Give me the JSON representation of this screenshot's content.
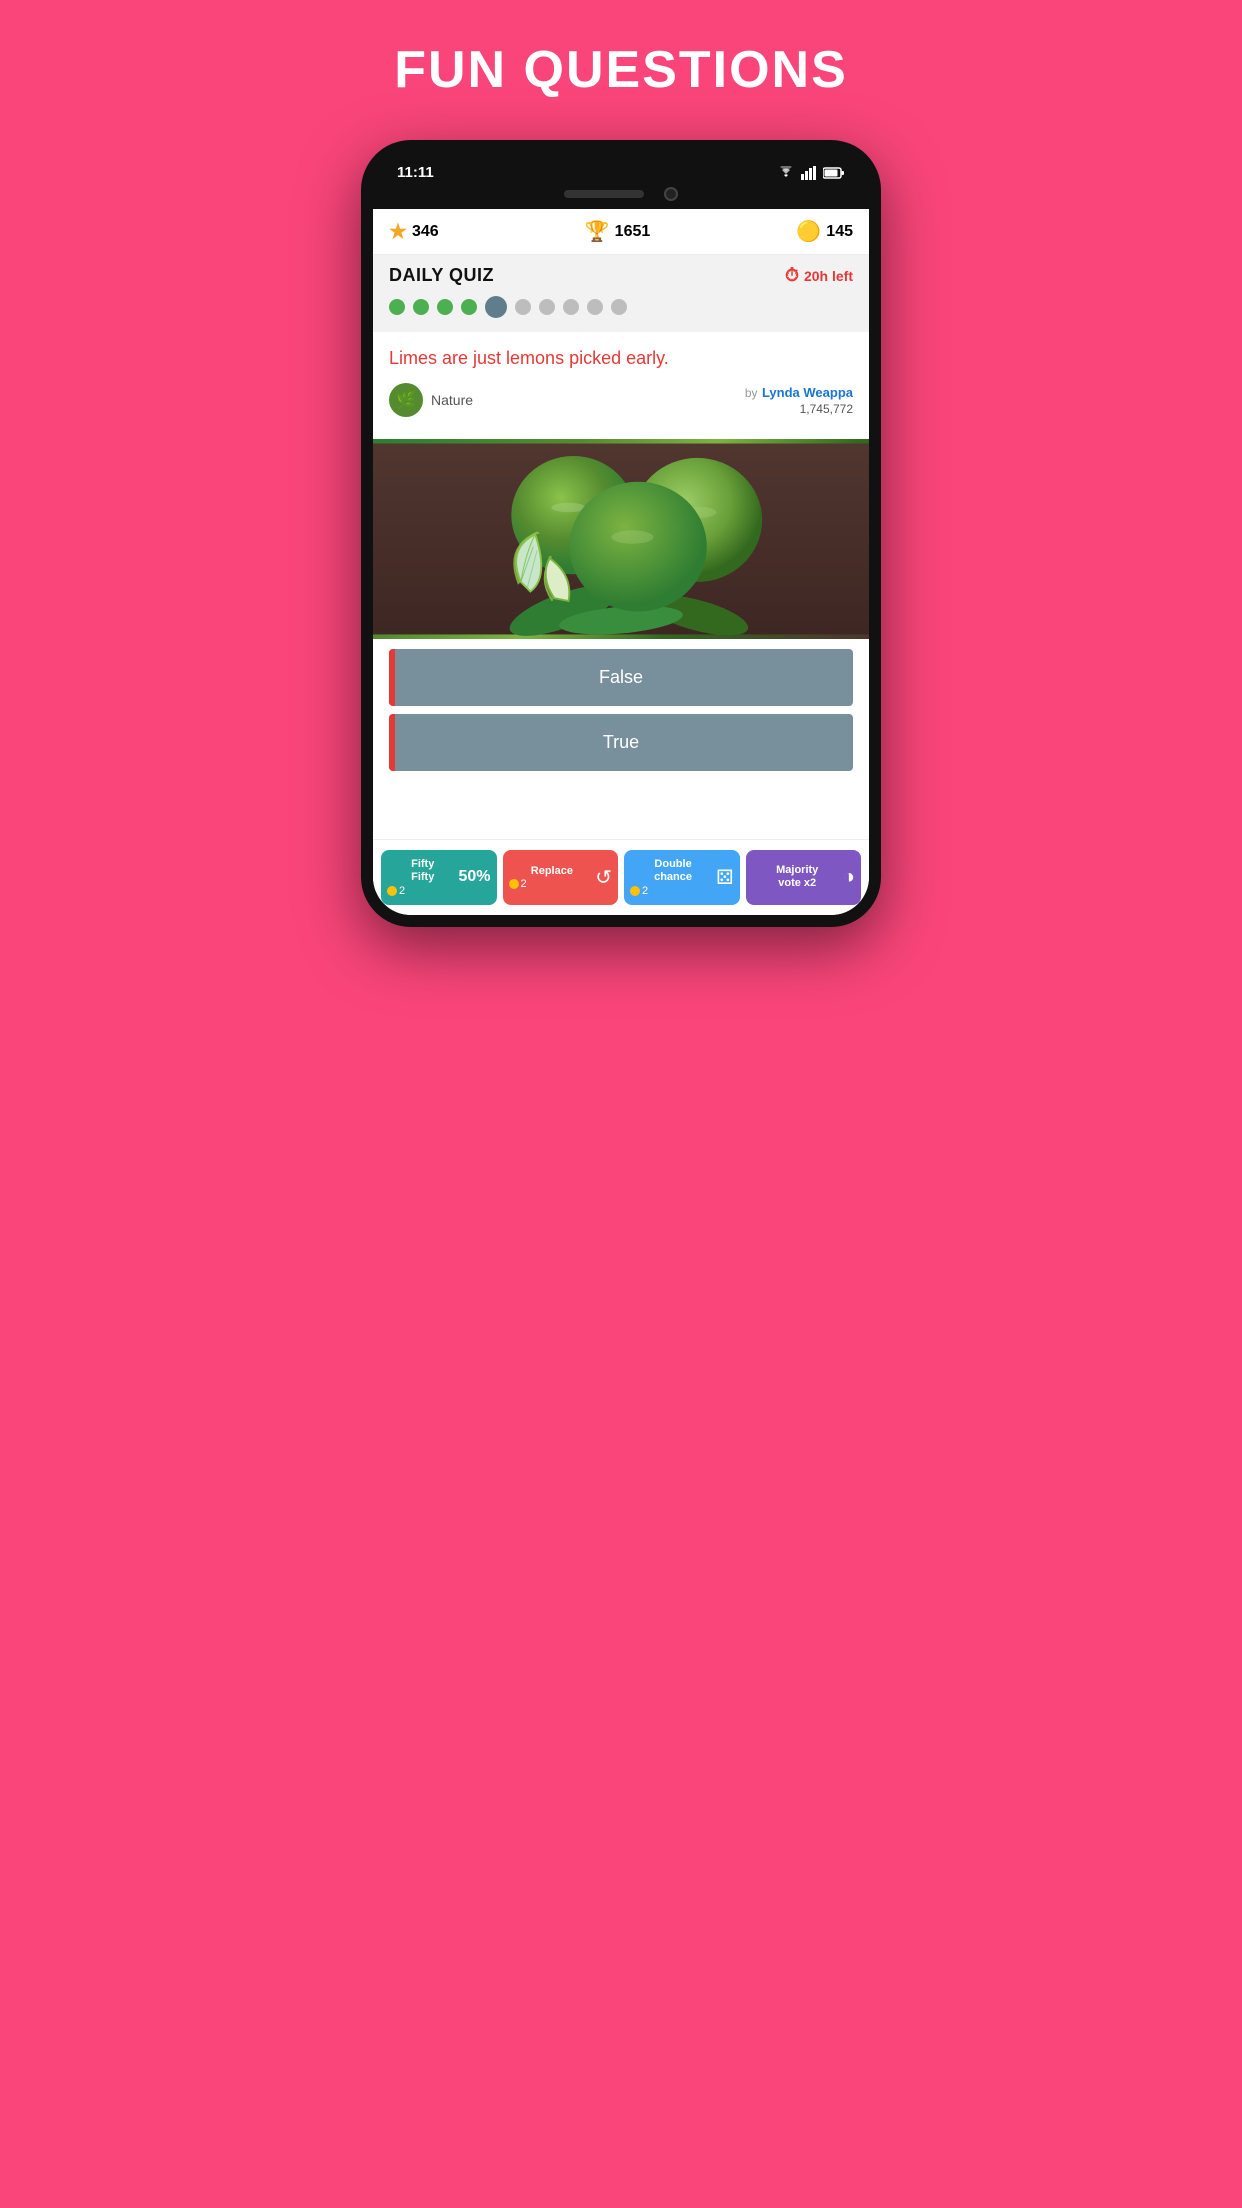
{
  "page": {
    "title": "FUN QUESTIONS",
    "background_color": "#F9457A"
  },
  "status_bar": {
    "time": "11:11"
  },
  "header": {
    "star_count": "346",
    "trophy_count": "1651",
    "coin_count": "145"
  },
  "daily_quiz": {
    "title": "DAILY QUIZ",
    "timer_label": "20h left",
    "progress_dots": [
      {
        "state": "completed"
      },
      {
        "state": "completed"
      },
      {
        "state": "completed"
      },
      {
        "state": "completed"
      },
      {
        "state": "current"
      },
      {
        "state": "upcoming"
      },
      {
        "state": "upcoming"
      },
      {
        "state": "upcoming"
      },
      {
        "state": "upcoming"
      },
      {
        "state": "upcoming"
      }
    ]
  },
  "question": {
    "text": "Limes are just lemons picked early.",
    "category": "Nature",
    "author_prefix": "by",
    "author_name": "Lynda Weappa",
    "author_score": "1,745,772"
  },
  "answers": [
    {
      "label": "False",
      "id": "false"
    },
    {
      "label": "True",
      "id": "true"
    }
  ],
  "powerups": [
    {
      "id": "fifty-fifty",
      "label": "Fifty\nFifty",
      "value_label": "50%",
      "icon": "½",
      "count": "2",
      "color_class": "pu-fifty"
    },
    {
      "id": "replace",
      "label": "Replace",
      "icon": "↺",
      "count": "2",
      "color_class": "pu-replace"
    },
    {
      "id": "double-chance",
      "label": "Double\nchance",
      "icon": "⚄",
      "count": "2",
      "color_class": "pu-double"
    },
    {
      "id": "majority-vote",
      "label": "Majority\nvote x2",
      "icon": "◑",
      "count": "",
      "color_class": "pu-majority"
    }
  ]
}
